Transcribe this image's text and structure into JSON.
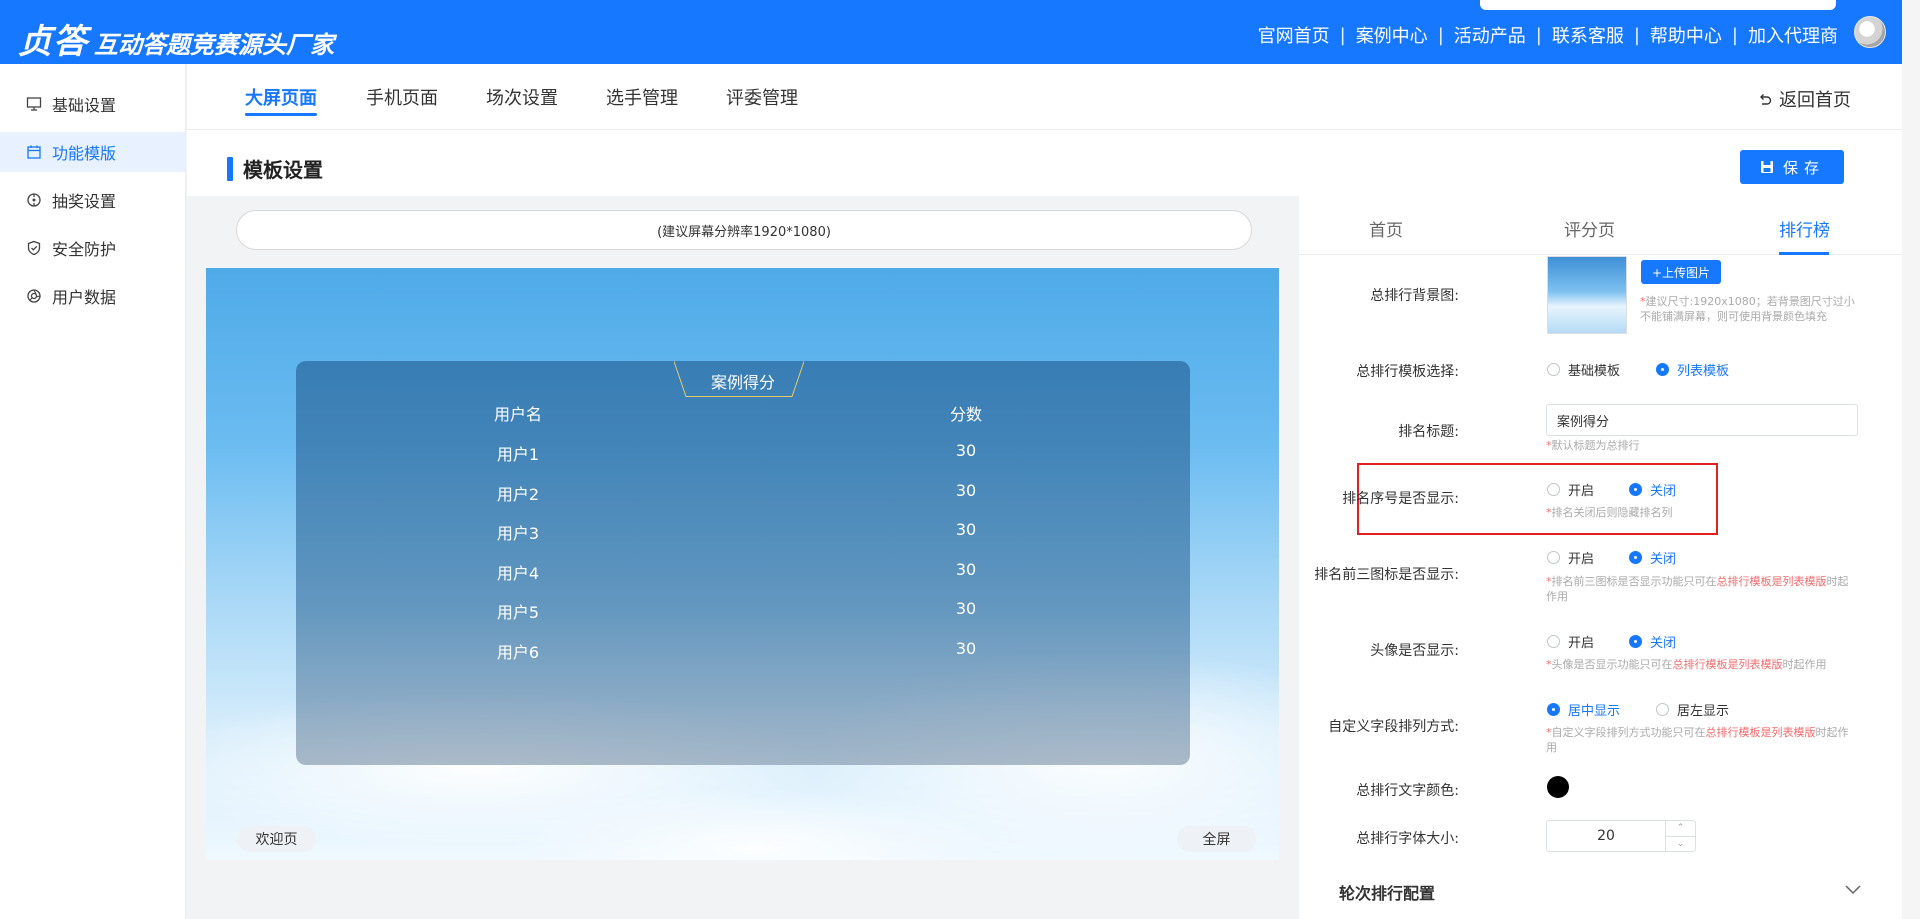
{
  "header": {
    "brand_main": "贞答",
    "brand_sub": "互动答题竞赛源头厂家",
    "nav": [
      "官网首页",
      "案例中心",
      "活动产品",
      "联系客服",
      "帮助中心",
      "加入代理商"
    ]
  },
  "sidebar": {
    "items": [
      {
        "label": "基础设置",
        "icon": "monitor-icon"
      },
      {
        "label": "功能模版",
        "icon": "calendar-icon"
      },
      {
        "label": "抽奖设置",
        "icon": "target-icon"
      },
      {
        "label": "安全防护",
        "icon": "shield-icon"
      },
      {
        "label": "用户数据",
        "icon": "aperture-icon"
      }
    ],
    "active_index": 1
  },
  "tabs": {
    "items": [
      "大屏页面",
      "手机页面",
      "场次设置",
      "选手管理",
      "评委管理"
    ],
    "active_index": 0,
    "back_label": "返回首页"
  },
  "section": {
    "title": "模板设置",
    "save_label": "保存"
  },
  "preview": {
    "resolution_hint": "(建议屏幕分辨率1920*1080)",
    "ranking_title": "案例得分",
    "col_user": "用户名",
    "col_score": "分数",
    "rows": [
      {
        "user": "用户1",
        "score": "30"
      },
      {
        "user": "用户2",
        "score": "30"
      },
      {
        "user": "用户3",
        "score": "30"
      },
      {
        "user": "用户4",
        "score": "30"
      },
      {
        "user": "用户5",
        "score": "30"
      },
      {
        "user": "用户6",
        "score": "30"
      }
    ],
    "welcome_btn": "欢迎页",
    "fullscreen_btn": "全屏"
  },
  "settings": {
    "tabs": [
      "首页",
      "评分页",
      "排行榜"
    ],
    "active_tab": 2,
    "bg_label": "总排行背景图:",
    "upload_label": "+上传图片",
    "bg_hint": "建议尺寸:1920x1080；若背景图尺寸过小不能铺满屏幕，则可使用背景颜色填充",
    "template_label": "总排行模板选择:",
    "template_options": [
      "基础模板",
      "列表模板"
    ],
    "template_selected": 1,
    "rank_title_label": "排名标题:",
    "rank_title_value": "案例得分",
    "rank_title_hint": "默认标题为总排行",
    "rank_no_label": "排名序号是否显示:",
    "rank_no_hint": "排名关闭后则隐藏排名列",
    "top3_label": "排名前三图标是否显示:",
    "top3_hint_a": "排名前三图标是否显示功能只可在",
    "top3_hint_red": "总排行模板是列表模版",
    "top3_hint_b": "时起作用",
    "avatar_label": "头像是否显示:",
    "avatar_hint_a": "头像是否显示功能只可在",
    "avatar_hint_red": "总排行模板是列表模版",
    "avatar_hint_b": "时起作用",
    "custom_label": "自定义字段排列方式:",
    "custom_options": [
      "居中显示",
      "居左显示"
    ],
    "custom_hint_a": "自定义字段排列方式功能只可在",
    "custom_hint_red": "总排行模板是列表模版",
    "custom_hint_b": "时起作用",
    "on_label": "开启",
    "off_label": "关闭",
    "text_color_label": "总排行文字颜色:",
    "text_color": "#000000",
    "font_size_label": "总排行字体大小:",
    "font_size_value": "20",
    "round_cfg_label": "轮次排行配置"
  },
  "colors": {
    "primary": "#1677ff",
    "highlight": "#e02020"
  }
}
